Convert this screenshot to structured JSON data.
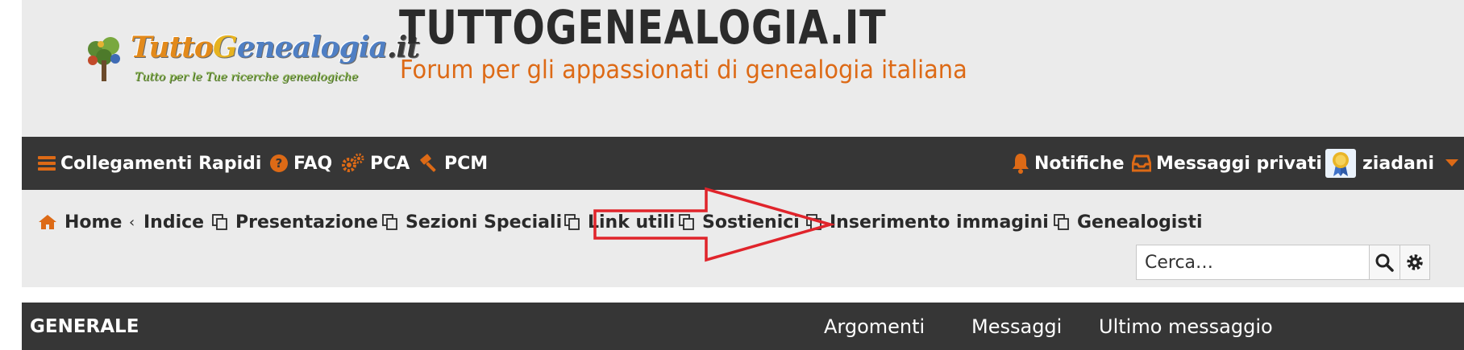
{
  "header": {
    "logo_word": "TuttoGenealogia",
    "logo_suffix": ".it",
    "logo_sub": "Tutto per le Tue ricerche genealogiche",
    "site_title": "TUTTOGENEALOGIA.IT",
    "site_description": "Forum per gli appassionati di genealogia italiana"
  },
  "navbar": {
    "left": [
      {
        "label": "Collegamenti Rapidi",
        "icon": "bars-icon"
      },
      {
        "label": "FAQ",
        "icon": "question-circle-icon"
      },
      {
        "label": "PCA",
        "icon": "cogs-icon"
      },
      {
        "label": "PCM",
        "icon": "gavel-icon"
      }
    ],
    "right": [
      {
        "label": "Notifiche",
        "icon": "bell-icon"
      },
      {
        "label": "Messaggi privati",
        "icon": "inbox-icon"
      },
      {
        "label": "ziadani",
        "icon": "avatar-badge"
      }
    ]
  },
  "breadcrumbs": [
    {
      "label": "Home",
      "icon": "home-icon"
    },
    {
      "label": "Indice",
      "icon": ""
    },
    {
      "label": "Presentazione",
      "icon": "copy-icon"
    },
    {
      "label": "Sezioni Speciali",
      "icon": "copy-icon"
    },
    {
      "label": "Link utili",
      "icon": "copy-icon"
    },
    {
      "label": "Sostienici",
      "icon": "copy-icon"
    },
    {
      "label": "Inserimento immagini",
      "icon": "copy-icon"
    },
    {
      "label": "Genealogisti",
      "icon": "copy-icon"
    }
  ],
  "breadcrumb_separator": "‹",
  "search": {
    "placeholder": "Cerca…"
  },
  "forum_header": {
    "title": "GENERALE",
    "col_topics": "Argomenti",
    "col_posts": "Messaggi",
    "col_last": "Ultimo messaggio"
  },
  "colors": {
    "accent": "#dd6a16",
    "navbar_bg": "#363636",
    "header_bg": "#ebebeb",
    "annotation_red": "#e0242b"
  }
}
